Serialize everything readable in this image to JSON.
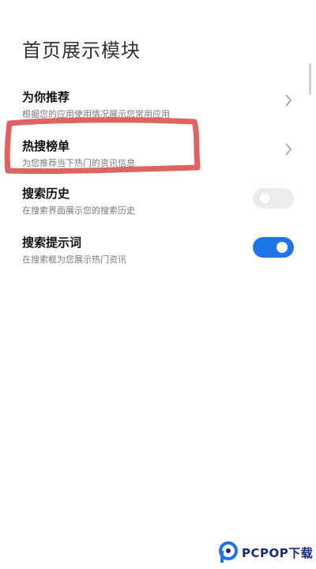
{
  "page": {
    "title": "首页展示模块"
  },
  "settings": [
    {
      "title": "为你推荐",
      "subtitle": "根据您的应用使用情况展示您常用应用",
      "control": "chevron"
    },
    {
      "title": "热搜榜单",
      "subtitle": "为您推荐当下热门的资讯信息",
      "control": "chevron"
    },
    {
      "title": "搜索历史",
      "subtitle": "在搜索界面展示您的搜索历史",
      "control": "toggle",
      "enabled": false
    },
    {
      "title": "搜索提示词",
      "subtitle": "在搜索框为您展示热门资讯",
      "control": "toggle",
      "enabled": true
    }
  ],
  "colors": {
    "toggle_on": "#1E74E9",
    "toggle_off": "#ECECEC",
    "highlight_mark": "#D9534F"
  },
  "watermark": {
    "text": "PCPOP下载"
  }
}
